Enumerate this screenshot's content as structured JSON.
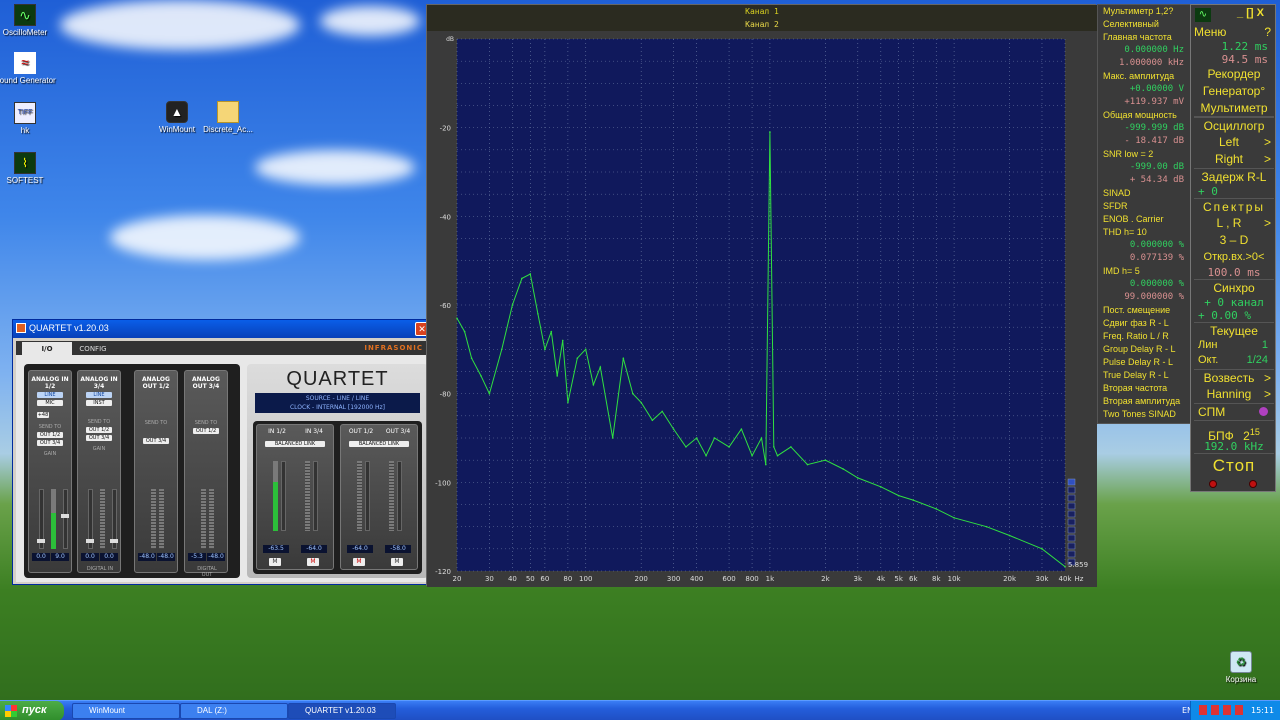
{
  "desktop": {
    "icons": [
      {
        "label": "OscilloMeter",
        "icon": "oscillometer-icon"
      },
      {
        "label": "Sound Generator",
        "icon": "sound-generator-icon"
      },
      {
        "label": "hk",
        "icon": "tiff-file-icon"
      },
      {
        "label": "SOFTEST",
        "icon": "softest-icon"
      },
      {
        "label": "WinMount",
        "icon": "winmount-icon"
      },
      {
        "label": "Discrete_Ac...",
        "icon": "folder-icon"
      },
      {
        "label": "Корзина",
        "icon": "recycle-bin-icon"
      }
    ]
  },
  "taskbar": {
    "start_label": "пуск",
    "tasks": [
      "WinMount",
      "DAL (Z:)",
      "QUARTET v1.20.03"
    ],
    "lang": "EN",
    "clock": "15:11"
  },
  "quartet": {
    "title": "QUARTET v1.20.03",
    "tabs": [
      "I/O",
      "CONFIG"
    ],
    "brand": "INFRASONIC",
    "logo": "QUARTET",
    "source": "SOURCE - LINE / LINE",
    "clock": "CLOCK - INTERNAL [192000 Hz]",
    "strips": [
      {
        "title": "ANALOG IN 1/2",
        "pills": [
          "LINE",
          "MIC"
        ],
        "extra": "+48",
        "send": [
          "OUT 1/2",
          "OUT 3/4"
        ],
        "gain": "GAIN",
        "values": [
          "0.0",
          "9.0"
        ],
        "footer": ""
      },
      {
        "title": "ANALOG IN 3/4",
        "pills": [
          "LINE",
          "INST"
        ],
        "extra": "",
        "send": [
          "OUT 1/2",
          "OUT 3/4"
        ],
        "gain": "GAIN",
        "values": [
          "0.0",
          "0.0"
        ],
        "footer": "DIGITAL IN"
      },
      {
        "title": "ANALOG OUT 1/2",
        "pills": [],
        "extra": "",
        "send": [
          "OUT 3/4"
        ],
        "gain": "",
        "values": [
          "-48.0",
          "-48.0"
        ],
        "footer": ""
      },
      {
        "title": "ANALOG OUT 3/4",
        "pills": [],
        "extra": "",
        "send": [
          "OUT 1/2"
        ],
        "gain": "",
        "values": [
          "-5.3",
          "-48.0"
        ],
        "footer": "DIGITAL OUT"
      }
    ],
    "send_to": "SEND TO",
    "monitors": [
      {
        "tabs": [
          "IN 1/2",
          "IN 3/4"
        ],
        "link": "BALANCED LINK",
        "values": [
          "-63.5",
          "-64.0"
        ],
        "mutes": [
          "M",
          "M"
        ]
      },
      {
        "tabs": [
          "OUT 1/2",
          "OUT 3/4"
        ],
        "link": "BALANCED LINK",
        "values": [
          "-64.0",
          "-58.0"
        ],
        "mutes": [
          "M",
          "M"
        ]
      }
    ]
  },
  "spectrum": {
    "channel1": "Канал 1",
    "channel2": "Канал 2",
    "corner_value": "5.859"
  },
  "chart_data": {
    "type": "line",
    "title": "",
    "xlabel": "Hz",
    "ylabel": "dB",
    "xscale": "log",
    "xlim": [
      20,
      40000
    ],
    "ylim": [
      -120,
      0
    ],
    "yticks": [
      -20,
      -40,
      -60,
      -80,
      -100,
      -120
    ],
    "xticks": [
      "20",
      "30",
      "40",
      "50",
      "60",
      "80",
      "100",
      "200",
      "300",
      "400",
      "600",
      "800",
      "1k",
      "2k",
      "3k",
      "4k",
      "5k",
      "6k",
      "8k",
      "10k",
      "20k",
      "30k",
      "40k"
    ],
    "series": [
      {
        "color": "#30e040",
        "x": [
          20,
          22,
          24,
          27,
          30,
          35,
          40,
          45,
          50,
          55,
          60,
          65,
          70,
          75,
          80,
          90,
          100,
          110,
          120,
          140,
          160,
          180,
          200,
          230,
          260,
          300,
          350,
          400,
          450,
          500,
          600,
          700,
          800,
          900,
          950,
          1000,
          1050,
          1100,
          1300,
          1600,
          2000,
          2500,
          3000,
          4000,
          5000,
          6000,
          8000,
          10000,
          15000,
          20000,
          30000,
          40000
        ],
        "y": [
          -63,
          -66,
          -72,
          -76,
          -80,
          -70,
          -60,
          -54,
          -53,
          -62,
          -70,
          -66,
          -76,
          -68,
          -82,
          -72,
          -70,
          -78,
          -74,
          -90,
          -72,
          -80,
          -82,
          -86,
          -84,
          -88,
          -92,
          -90,
          -94,
          -90,
          -92,
          -88,
          -94,
          -90,
          -96,
          -21,
          -92,
          -94,
          -92,
          -96,
          -95,
          -97,
          -99,
          -101,
          -103,
          -104,
          -106,
          -108,
          -110,
          -112,
          -115,
          -119
        ]
      }
    ]
  },
  "multimeter": {
    "lines": [
      {
        "t": "Мультиметр 1,2?",
        "c": "y"
      },
      {
        "t": "Селективный",
        "c": "y"
      },
      {
        "t": "Главная частота",
        "c": "y"
      },
      {
        "t": "0.000000 Hz",
        "c": "g"
      },
      {
        "t": "1.000000 kHz",
        "c": "p"
      },
      {
        "t": "Макс. амплитуда",
        "c": "y"
      },
      {
        "t": "+0.00000 V",
        "c": "g"
      },
      {
        "t": "+119.937 mV",
        "c": "p"
      },
      {
        "t": "Общая мощность",
        "c": "y"
      },
      {
        "t": "-999.999 dB",
        "c": "g"
      },
      {
        "t": "- 18.417 dB",
        "c": "p"
      },
      {
        "t": "SNR   low =  2",
        "c": "y"
      },
      {
        "t": "-999.00 dB",
        "c": "g"
      },
      {
        "t": "+ 54.34 dB",
        "c": "p"
      },
      {
        "t": "SINAD",
        "c": "y"
      },
      {
        "t": "SFDR",
        "c": "y"
      },
      {
        "t": "ENOB . Carrier",
        "c": "y"
      },
      {
        "t": "THD    h=  10",
        "c": "y"
      },
      {
        "t": "0.000000 %",
        "c": "g"
      },
      {
        "t": "0.077139 %",
        "c": "p"
      },
      {
        "t": "IMD    h=  5",
        "c": "y"
      },
      {
        "t": "0.000000 %",
        "c": "g"
      },
      {
        "t": "99.000000 %",
        "c": "p"
      },
      {
        "t": "Пост. смещение",
        "c": "y"
      },
      {
        "t": "Сдвиг фаз R - L",
        "c": "y"
      },
      {
        "t": "Freq. Ratio  L / R",
        "c": "y"
      },
      {
        "t": "Group Delay R - L",
        "c": "y"
      },
      {
        "t": "Pulse Delay R - L",
        "c": "y"
      },
      {
        "t": "True Delay R - L",
        "c": "y"
      },
      {
        "t": "Вторая частота",
        "c": "y"
      },
      {
        "t": "Вторая амплитуда",
        "c": "y"
      },
      {
        "t": "Two Tones SINAD",
        "c": "y"
      }
    ]
  },
  "control": {
    "menu": "Меню",
    "help": "?",
    "win_buttons": [
      "_",
      "[]",
      "X"
    ],
    "time1": "1.22 ms",
    "time2": "94.5 ms",
    "recorder": "Рекордер",
    "generator": "Генератор°",
    "multimeter": "Мультиметр",
    "oscilloscope": "Осциллогр",
    "left": "Left",
    "right": "Right",
    "delay": "Задерж R-L",
    "delay_val": "+    0",
    "spectra": "Спектры",
    "lr": "L , R",
    "d3": "3 – D",
    "open_input": "Откр.вх.>0<",
    "open_val": "100.0 ms",
    "sync": "Синхро",
    "sync_ch": "+ 0 канал",
    "sync_pct": "+ 0.00 %",
    "current": "Текущее",
    "lin": "Лин",
    "lin_val": "1",
    "oct": "Окт.",
    "oct_val": "1/24",
    "power": "Возвесть",
    "window": "Hanning",
    "spm": "СПМ",
    "fft": "БПФ",
    "fft_base": "2",
    "fft_exp": "15",
    "rate": "192.0 kHz",
    "stop": "Стоп"
  }
}
